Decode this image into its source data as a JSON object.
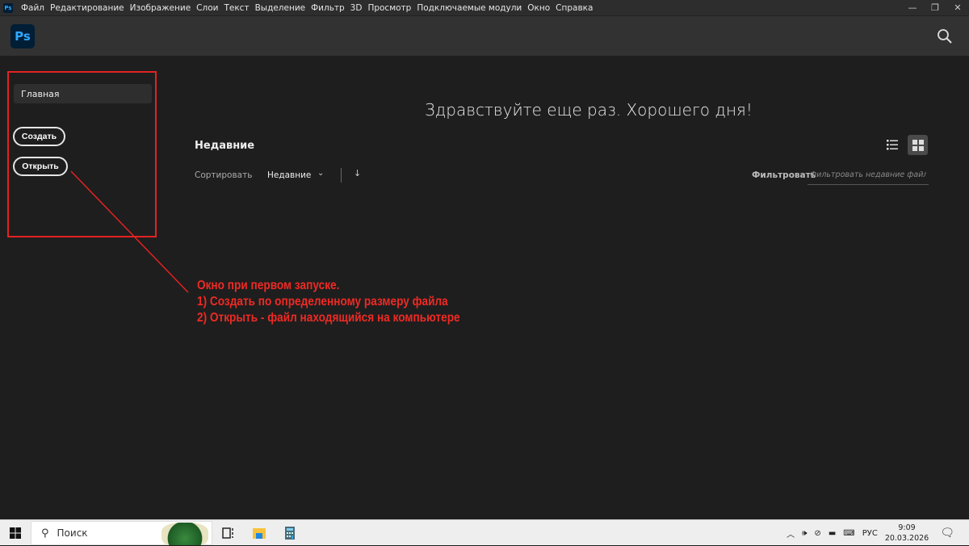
{
  "menubar": {
    "items": [
      "Файл",
      "Редактирование",
      "Изображение",
      "Слои",
      "Текст",
      "Выделение",
      "Фильтр",
      "3D",
      "Просмотр",
      "Подключаемые модули",
      "Окно",
      "Справка"
    ],
    "app_icon": "Ps"
  },
  "header": {
    "logo": "Ps",
    "search_icon": "search-icon"
  },
  "sidebar": {
    "home": "Главная",
    "create": "Создать",
    "open": "Открыть"
  },
  "main": {
    "greeting": "Здравствуйте еще раз. Хорошего дня!",
    "recent_title": "Недавние",
    "sort_label": "Сортировать",
    "sort_value": "Недавние",
    "filter_label": "Фильтровать",
    "filter_placeholder": "Фильтровать недавние файлы",
    "view_mode": "grid"
  },
  "annotation": {
    "lines": [
      "Окно при первом запуске.",
      "1) Создать по определенному размеру файла",
      "2) Открыть - файл находящийся на компьютере"
    ],
    "color": "#ee2a24"
  },
  "taskbar": {
    "search_placeholder": "Поиск",
    "language": "РУС",
    "time": "9:09",
    "date": "20.03.2026"
  },
  "colors": {
    "ps_blue": "#31a8ff",
    "annotation_red": "#e32222"
  }
}
